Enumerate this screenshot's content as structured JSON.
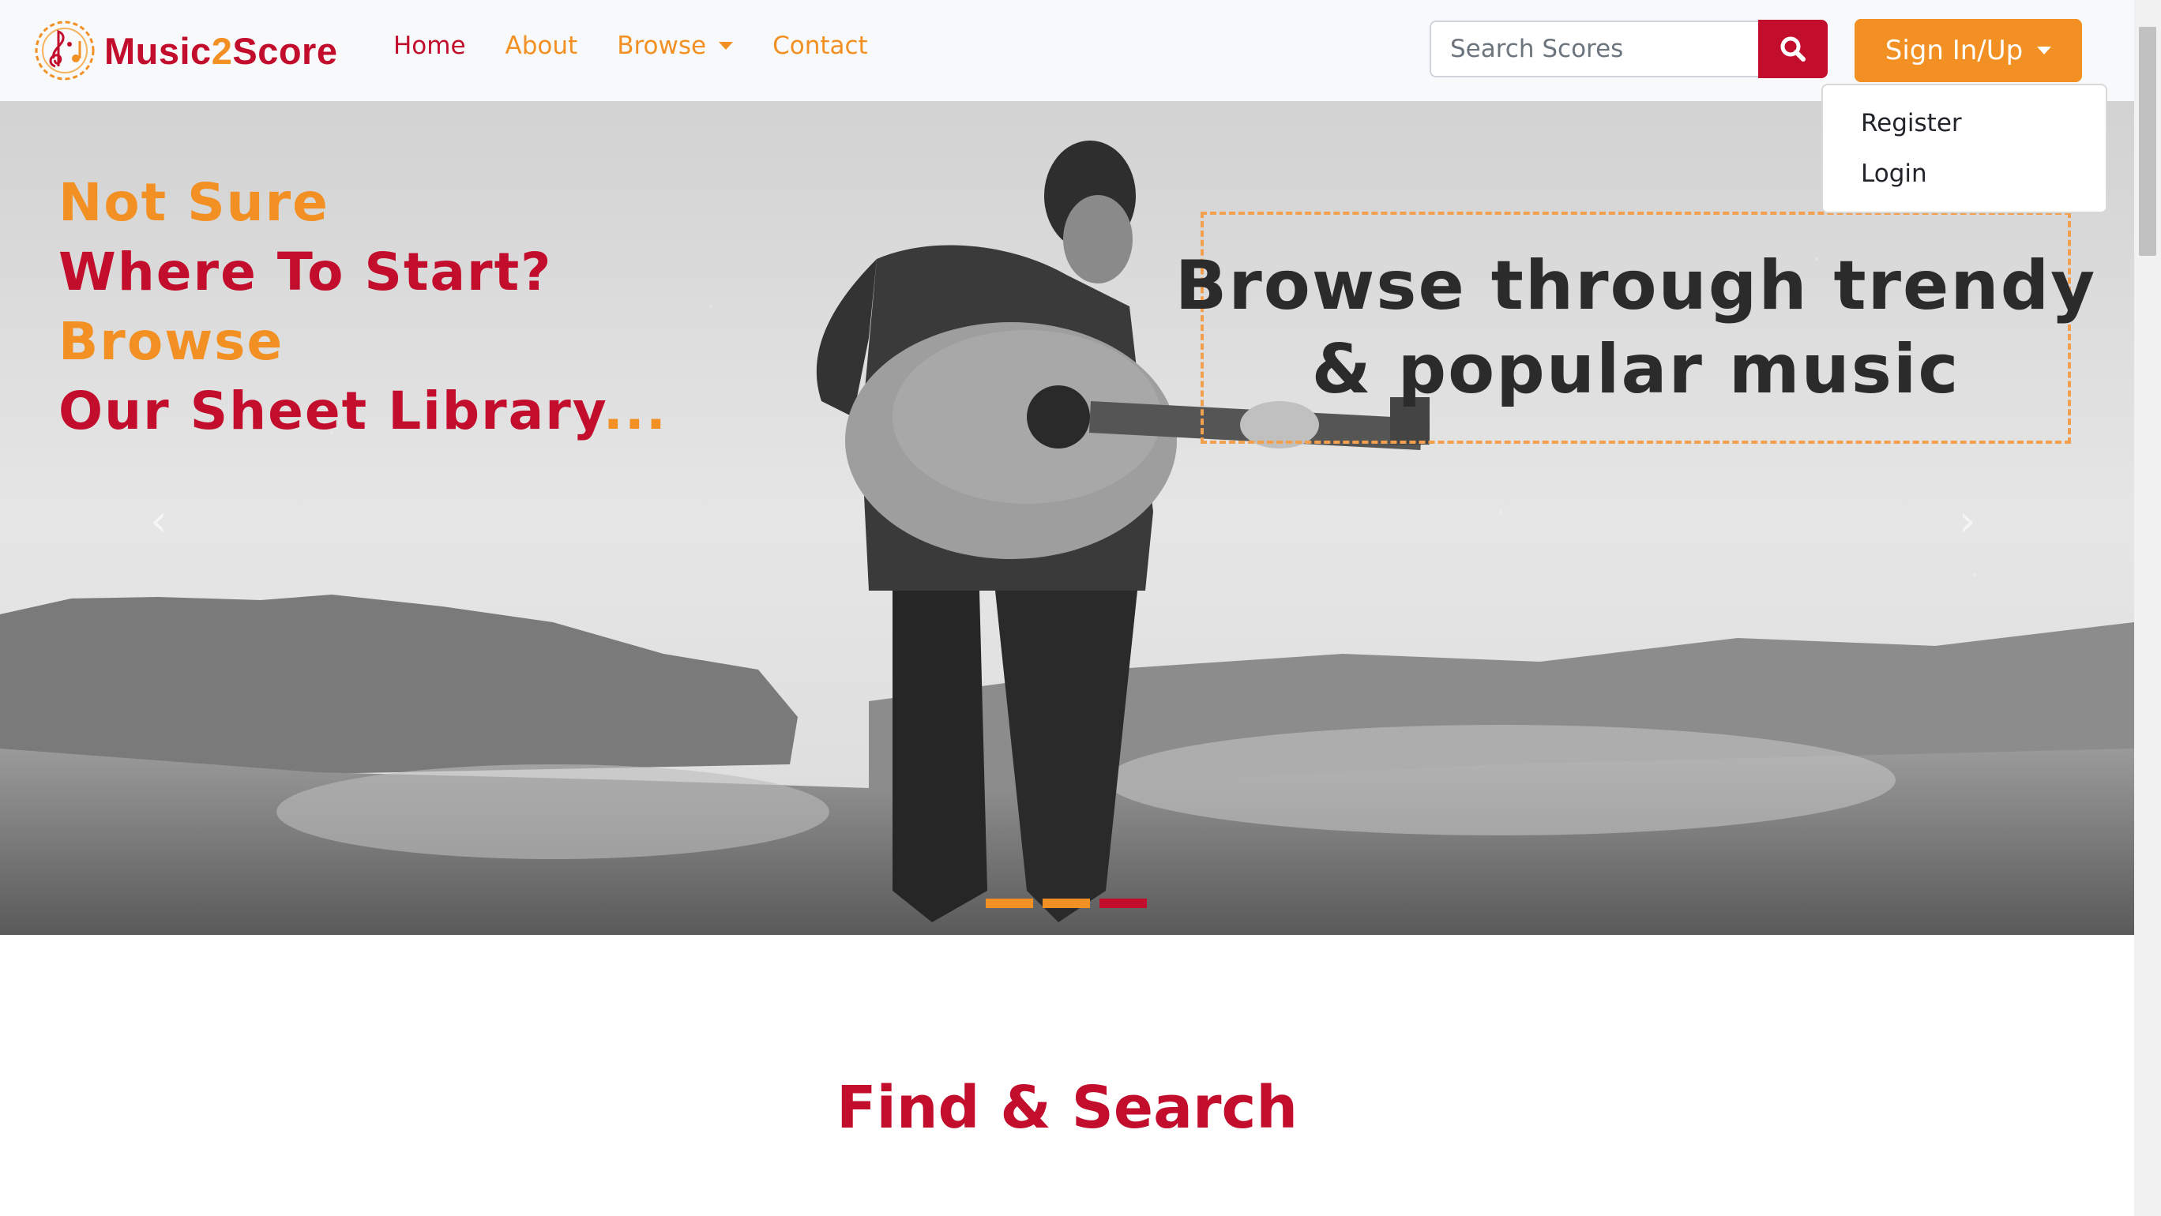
{
  "brand": {
    "name_part1": "Music",
    "name_part2": "2",
    "name_part3": "Score"
  },
  "nav": {
    "home": "Home",
    "about": "About",
    "browse": "Browse",
    "contact": "Contact"
  },
  "search": {
    "placeholder": "Search Scores",
    "button_icon": "search-icon"
  },
  "auth": {
    "button_label": "Sign In/Up",
    "dropdown": {
      "register": "Register",
      "login": "Login"
    }
  },
  "hero": {
    "left_lines": [
      {
        "text": "Not Sure",
        "color": "orange"
      },
      {
        "text": "Where To Start?",
        "color": "red"
      },
      {
        "text": "Browse",
        "color": "orange"
      },
      {
        "text": "Our Sheet Library",
        "suffix": "...",
        "color": "red"
      }
    ],
    "box_line1": "Browse through trendy",
    "box_line2": "& popular music",
    "indicators": 3,
    "active_indicator": 3
  },
  "section": {
    "title": "Find & Search"
  },
  "colors": {
    "primary_red": "#c20e2c",
    "accent_orange": "#f29023",
    "navbar_bg": "#f8f9fa"
  }
}
